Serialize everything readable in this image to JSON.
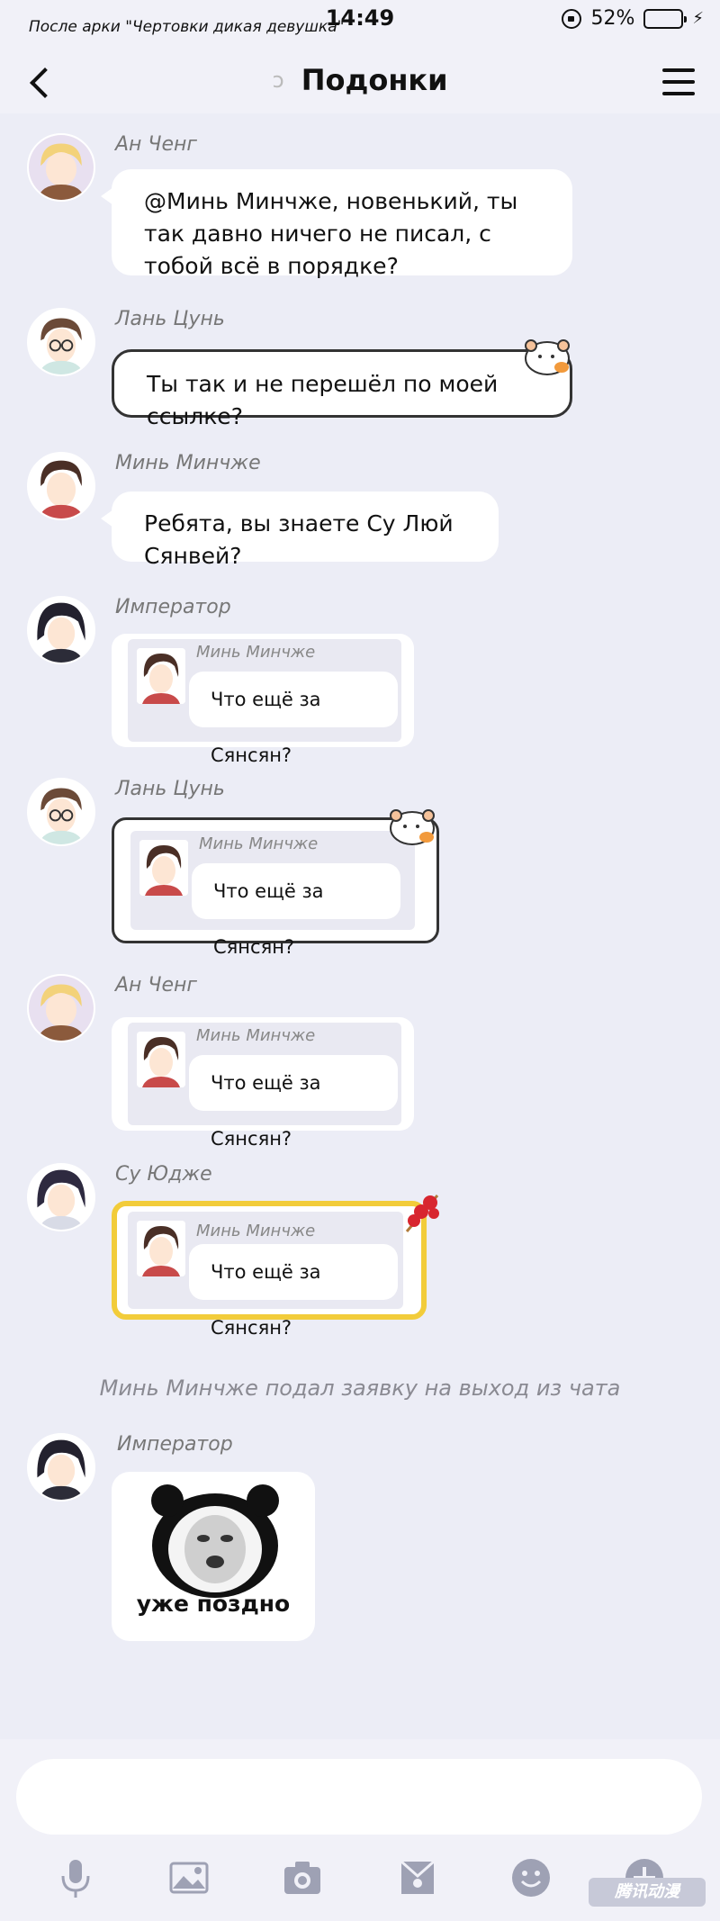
{
  "status_bar": {
    "left_text": "После арки \"Чертовки дикая девушка\"",
    "time": "14:49",
    "battery": "52%",
    "battery_level": 0.52
  },
  "nav": {
    "title": "Подонки"
  },
  "messages": [
    {
      "sender": "Ан Ченг",
      "text": "@Минь Минчже, новенький, ты так давно ничего не писал, с тобой всё в порядке?"
    },
    {
      "sender": "Лань Цунь",
      "text": "Ты так и не перешёл по моей ссылке?"
    },
    {
      "sender": "Минь Минчже",
      "text": "Ребята, вы знаете Су Люй Сянвей?"
    },
    {
      "sender": "Император",
      "quote_name": "Минь Минчже",
      "quote_text": "Что ещё за Сянсян?"
    },
    {
      "sender": "Лань Цунь",
      "quote_name": "Минь Минчже",
      "quote_text": "Что ещё за Сянсян?"
    },
    {
      "sender": "Ан Ченг",
      "quote_name": "Минь Минчже",
      "quote_text": "Что ещё за Сянсян?"
    },
    {
      "sender": "Су Юдже",
      "quote_name": "Минь Минчже",
      "quote_text": "Что ещё за Сянсян?"
    },
    {
      "sender": "Император",
      "sticker_caption": "уже поздно"
    }
  ],
  "system_note": "Минь Минчже подал заявку на выход из чата",
  "composer": {
    "placeholder": ""
  },
  "toolbar_icons": [
    "microphone-icon",
    "image-icon",
    "camera-icon",
    "envelope-icon",
    "emoji-icon",
    "plus-icon"
  ]
}
